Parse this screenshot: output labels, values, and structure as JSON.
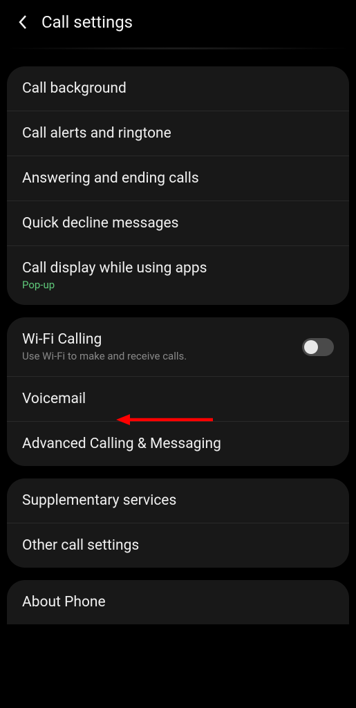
{
  "header": {
    "title": "Call settings"
  },
  "group1": {
    "items": [
      {
        "label": "Call background"
      },
      {
        "label": "Call alerts and ringtone"
      },
      {
        "label": "Answering and ending calls"
      },
      {
        "label": "Quick decline messages"
      },
      {
        "label": "Call display while using apps",
        "sublabel": "Pop-up"
      }
    ]
  },
  "group2": {
    "items": [
      {
        "label": "Wi-Fi Calling",
        "sublabel": "Use Wi-Fi to make and receive calls."
      },
      {
        "label": "Voicemail"
      },
      {
        "label": "Advanced Calling & Messaging"
      }
    ]
  },
  "group3": {
    "items": [
      {
        "label": "Supplementary services"
      },
      {
        "label": "Other call settings"
      }
    ]
  },
  "group4": {
    "items": [
      {
        "label": "About Phone"
      }
    ]
  }
}
